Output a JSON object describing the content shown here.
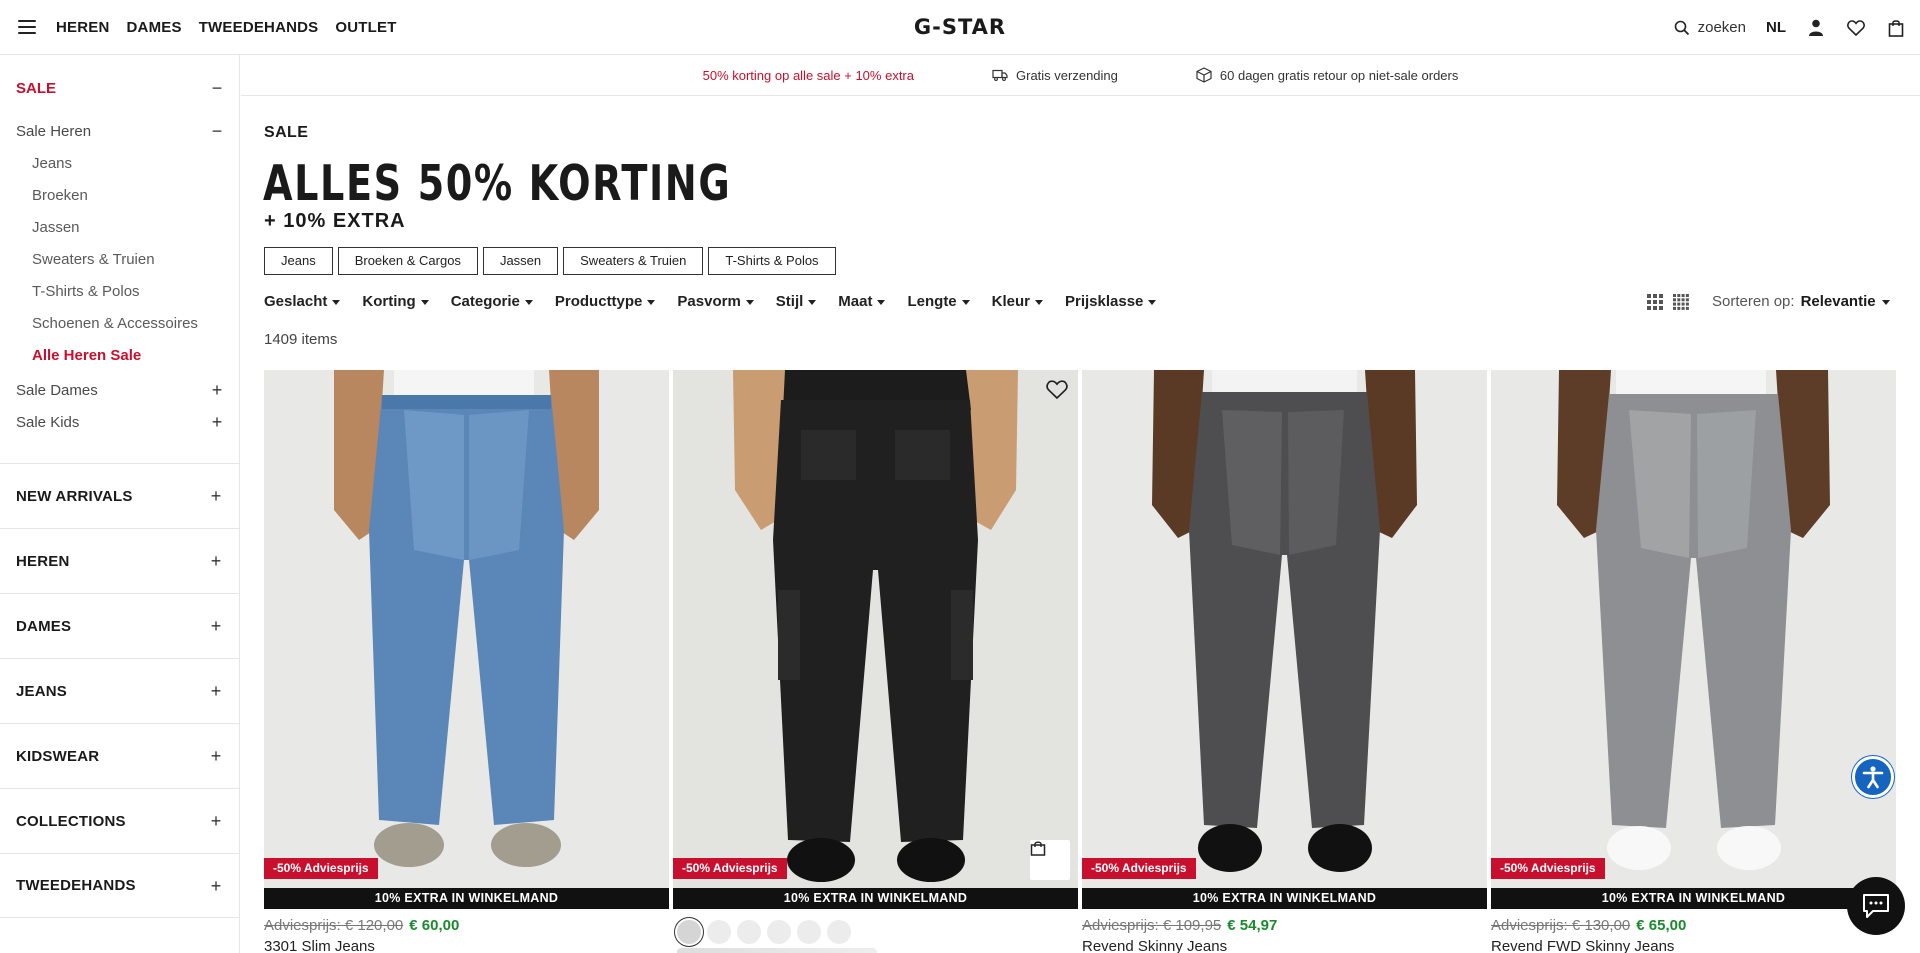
{
  "header": {
    "nav": [
      "HEREN",
      "DAMES",
      "TWEEDEHANDS",
      "OUTLET"
    ],
    "logo": "G-STAR",
    "search_label": "zoeken",
    "language": "NL"
  },
  "sidebar": {
    "sale_title": "SALE",
    "sale_heren": "Sale Heren",
    "heren_items": [
      "Jeans",
      "Broeken",
      "Jassen",
      "Sweaters & Truien",
      "T-Shirts & Polos",
      "Schoenen & Accessoires"
    ],
    "heren_all": "Alle Heren Sale",
    "sale_dames": "Sale Dames",
    "sale_kids": "Sale Kids",
    "sections": [
      "NEW ARRIVALS",
      "HEREN",
      "DAMES",
      "JEANS",
      "KIDSWEAR",
      "COLLECTIONS",
      "TWEEDEHANDS"
    ]
  },
  "usp": {
    "promo": "50% korting op alle sale + 10% extra",
    "shipping": "Gratis verzending",
    "returns": "60 dagen gratis retour op niet-sale orders"
  },
  "main": {
    "breadcrumb": "SALE",
    "headline": "ALLES 50% KORTING",
    "subline": "+ 10% EXTRA",
    "chips": [
      "Jeans",
      "Broeken & Cargos",
      "Jassen",
      "Sweaters & Truien",
      "T-Shirts & Polos"
    ],
    "filters": [
      "Geslacht",
      "Korting",
      "Categorie",
      "Producttype",
      "Pasvorm",
      "Stijl",
      "Maat",
      "Lengte",
      "Kleur",
      "Prijsklasse"
    ],
    "item_count": "1409 items",
    "sort_label": "Sorteren op:",
    "sort_value": "Relevantie"
  },
  "products": [
    {
      "name": "3301 Slim Jeans",
      "old_price": "Adviesprijs: € 120,00",
      "new_price": "€ 60,00",
      "badge": "-50% Adviesprijs",
      "extra": "10% EXTRA IN WINKELMAND"
    },
    {
      "name": "",
      "old_price": "",
      "new_price": "",
      "badge": "-50% Adviesprijs",
      "extra": "10% EXTRA IN WINKELMAND"
    },
    {
      "name": "Revend Skinny Jeans",
      "old_price": "Adviesprijs: € 109,95",
      "new_price": "€ 54,97",
      "badge": "-50% Adviesprijs",
      "extra": "10% EXTRA IN WINKELMAND"
    },
    {
      "name": "Revend FWD Skinny Jeans",
      "old_price": "Adviesprijs: € 130,00",
      "new_price": "€ 65,00",
      "badge": "-50% Adviesprijs",
      "extra": "10% EXTRA IN WINKELMAND"
    }
  ],
  "colors": {
    "sale_red": "#c8102e",
    "price_green": "#1a8a2e",
    "a11y_blue": "#1565c0"
  }
}
